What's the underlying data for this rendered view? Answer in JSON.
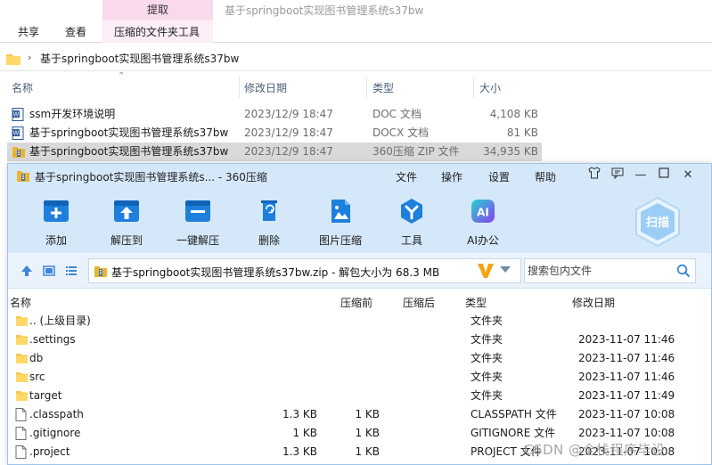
{
  "explorer": {
    "window_title": "基于springboot实现图书管理系统s37bw",
    "ribbon": {
      "context_group": "提取",
      "tabs": [
        "共享",
        "查看",
        "压缩的文件夹工具"
      ]
    },
    "address_path": "基于springboot实现图书管理系统s37bw",
    "columns": {
      "name": "名称",
      "date": "修改日期",
      "type": "类型",
      "size": "大小"
    },
    "files": [
      {
        "name": "ssm开发环境说明",
        "date": "2023/12/9 18:47",
        "type": "DOC 文档",
        "size": "4,108 KB",
        "icon": "word-doc-icon"
      },
      {
        "name": "基于springboot实现图书管理系统s37bw",
        "date": "2023/12/9 18:47",
        "type": "DOCX 文档",
        "size": "81 KB",
        "icon": "word-docx-icon"
      },
      {
        "name": "基于springboot实现图书管理系统s37bw",
        "date": "2023/12/9 18:47",
        "type": "360压缩 ZIP 文件",
        "size": "34,935 KB",
        "icon": "zip-archive-icon"
      }
    ]
  },
  "zip_window": {
    "title": "基于springboot实现图书管理系统s... - 360压缩",
    "menu": [
      "文件",
      "操作",
      "设置",
      "帮助"
    ],
    "toolbar": [
      {
        "label": "添加",
        "icon": "add-icon"
      },
      {
        "label": "解压到",
        "icon": "extract-to-icon"
      },
      {
        "label": "一键解压",
        "icon": "one-click-extract-icon"
      },
      {
        "label": "删除",
        "icon": "delete-icon"
      },
      {
        "label": "图片压缩",
        "icon": "image-compress-icon"
      },
      {
        "label": "工具",
        "icon": "tools-icon"
      },
      {
        "label": "AI办公",
        "icon": "ai-office-icon"
      }
    ],
    "scan_label": "扫描",
    "path_text": "基于springboot实现图书管理系统s37bw.zip - 解包大小为 68.3 MB",
    "search_placeholder": "搜索包内文件",
    "columns": {
      "name": "名称",
      "size": "压缩前",
      "compressed": "压缩后",
      "type": "类型",
      "date": "修改日期"
    },
    "rows": [
      {
        "name": ".. (上级目录)",
        "size": "",
        "compressed": "",
        "type": "文件夹",
        "date": "",
        "icon": "folder-icon"
      },
      {
        "name": ".settings",
        "size": "",
        "compressed": "",
        "type": "文件夹",
        "date": "2023-11-07 11:46",
        "icon": "folder-icon"
      },
      {
        "name": "db",
        "size": "",
        "compressed": "",
        "type": "文件夹",
        "date": "2023-11-07 11:46",
        "icon": "folder-icon"
      },
      {
        "name": "src",
        "size": "",
        "compressed": "",
        "type": "文件夹",
        "date": "2023-11-07 11:46",
        "icon": "folder-icon"
      },
      {
        "name": "target",
        "size": "",
        "compressed": "",
        "type": "文件夹",
        "date": "2023-11-07 11:49",
        "icon": "folder-icon"
      },
      {
        "name": ".classpath",
        "size": "1.3 KB",
        "compressed": "1 KB",
        "type": "CLASSPATH 文件",
        "date": "2023-11-07 10:08",
        "icon": "file-icon"
      },
      {
        "name": ".gitignore",
        "size": "1 KB",
        "compressed": "1 KB",
        "type": "GITIGNORE 文件",
        "date": "2023-11-07 10:08",
        "icon": "file-icon"
      },
      {
        "name": ".project",
        "size": "1.3 KB",
        "compressed": "1 KB",
        "type": "PROJECT 文件",
        "date": "2023-11-07 10:08",
        "icon": "file-icon"
      }
    ]
  },
  "watermark": "CSDN @全栈程序毕设"
}
